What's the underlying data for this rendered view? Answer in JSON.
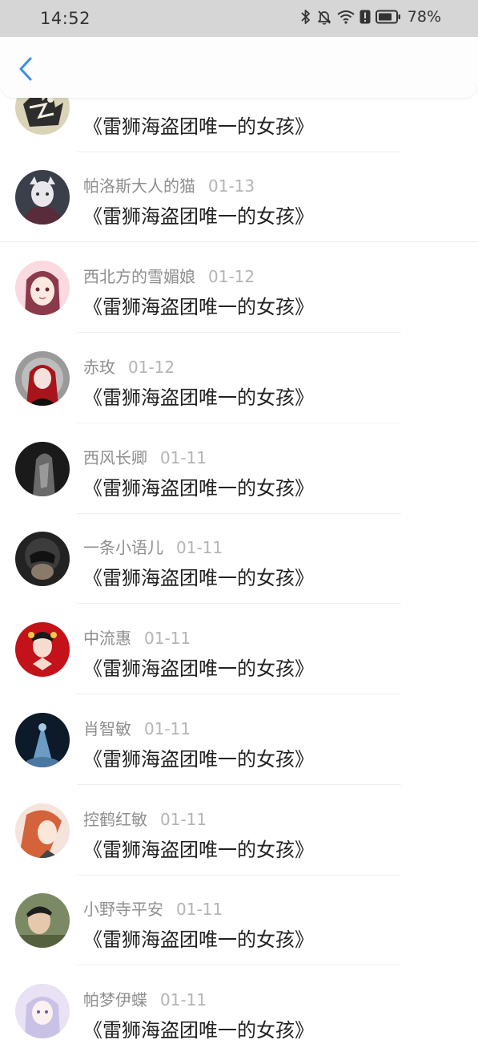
{
  "status_bar": {
    "time": "14:52",
    "battery": "78%",
    "icons": [
      "bluetooth-icon",
      "mute-icon",
      "wifi-icon",
      "alert-icon",
      "battery-icon"
    ]
  },
  "header": {
    "back_icon": "chevron-left-icon",
    "accent_color": "#3a8ee6"
  },
  "comments": [
    {
      "user": "",
      "date": "",
      "text": "《雷狮海盗团唯一的女孩》"
    },
    {
      "user": "帕洛斯大人的猫",
      "date": "01-13",
      "text": "《雷狮海盗团唯一的女孩》"
    },
    {
      "user": "西北方的雪媚娘",
      "date": "01-12",
      "text": "《雷狮海盗团唯一的女孩》"
    },
    {
      "user": "赤玫",
      "date": "01-12",
      "text": "《雷狮海盗团唯一的女孩》"
    },
    {
      "user": "西风长卿",
      "date": "01-11",
      "text": "《雷狮海盗团唯一的女孩》"
    },
    {
      "user": "一条小语儿",
      "date": "01-11",
      "text": "《雷狮海盗团唯一的女孩》"
    },
    {
      "user": "中流惠",
      "date": "01-11",
      "text": "《雷狮海盗团唯一的女孩》"
    },
    {
      "user": "肖智敏",
      "date": "01-11",
      "text": "《雷狮海盗团唯一的女孩》"
    },
    {
      "user": "控鹤红敏",
      "date": "01-11",
      "text": "《雷狮海盗团唯一的女孩》"
    },
    {
      "user": "小野寺平安",
      "date": "01-11",
      "text": "《雷狮海盗团唯一的女孩》"
    },
    {
      "user": "帕梦伊蝶",
      "date": "01-11",
      "text": "《雷狮海盗团唯一的女孩》"
    }
  ]
}
